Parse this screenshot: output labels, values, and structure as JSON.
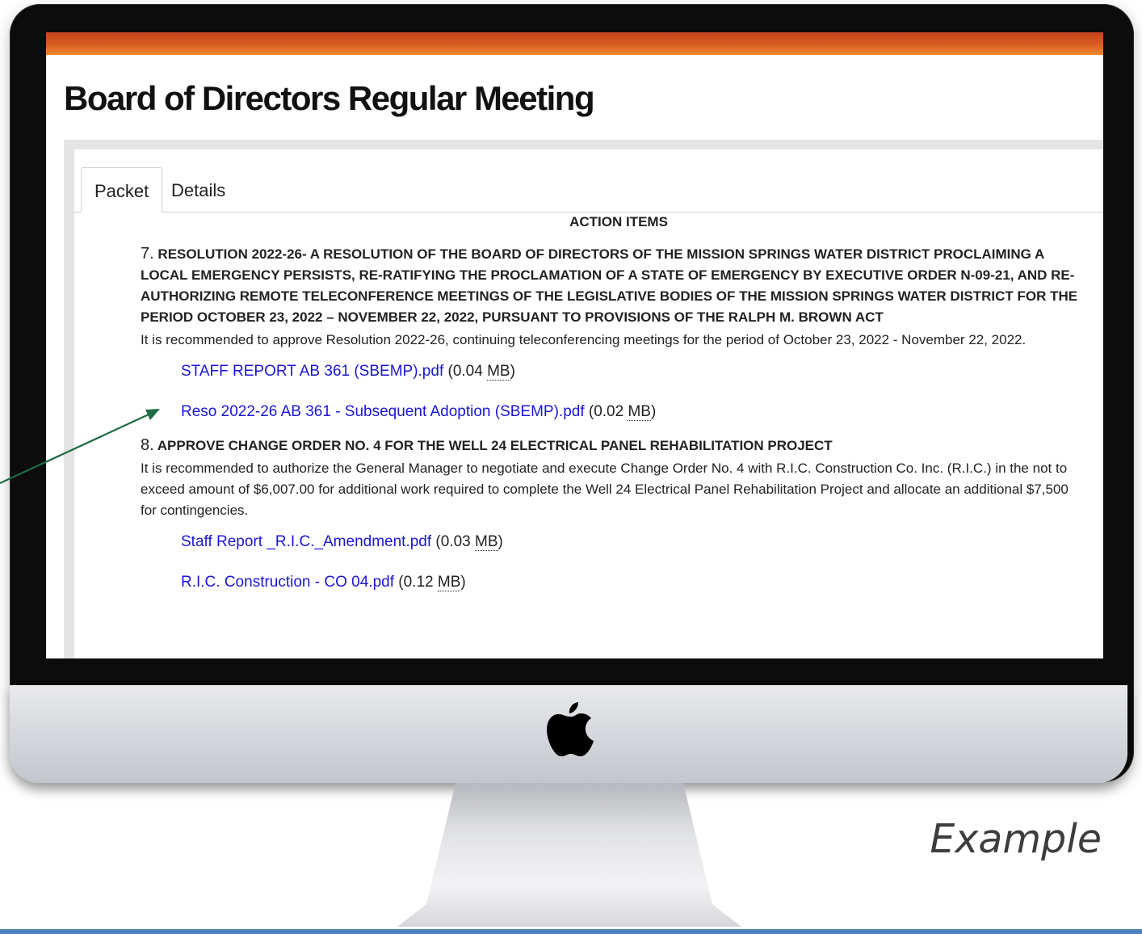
{
  "page": {
    "title": "Board of Directors Regular Meeting",
    "tabs": [
      {
        "label": "Packet",
        "active": true
      },
      {
        "label": "Details",
        "active": false
      }
    ]
  },
  "agenda": {
    "section_heading": "ACTION ITEMS",
    "items": [
      {
        "number": "7.",
        "title": "RESOLUTION 2022-26- A RESOLUTION OF THE BOARD OF DIRECTORS OF THE MISSION SPRINGS WATER DISTRICT PROCLAIMING A LOCAL EMERGENCY PERSISTS, RE-RATIFYING THE PROCLAMATION OF A STATE OF EMERGENCY BY EXECUTIVE ORDER N-09-21, AND RE-AUTHORIZING REMOTE TELECONFERENCE MEETINGS OF THE LEGISLATIVE BODIES OF THE MISSION SPRINGS WATER DISTRICT FOR THE PERIOD OCTOBER 23, 2022 – NOVEMBER 22, 2022, PURSUANT TO PROVISIONS OF THE RALPH M. BROWN ACT",
        "description": "It is recommended to approve Resolution 2022-26, continuing teleconferencing meetings for the period of October 23, 2022 - November 22, 2022.",
        "attachments": [
          {
            "name": "STAFF REPORT AB 361 (SBEMP).pdf",
            "size_open": " (0.04 ",
            "unit": "MB",
            "size_close": ")"
          },
          {
            "name": "Reso 2022-26 AB 361 - Subsequent Adoption (SBEMP).pdf",
            "size_open": " (0.02 ",
            "unit": "MB",
            "size_close": ")"
          }
        ]
      },
      {
        "number": "8.",
        "title": "APPROVE CHANGE ORDER NO. 4 FOR THE WELL 24 ELECTRICAL PANEL REHABILITATION PROJECT",
        "description": "It is recommended to authorize the General Manager to negotiate and execute Change Order No. 4 with R.I.C. Construction Co. Inc. (R.I.C.) in the not to exceed amount of $6,007.00 for additional work required to complete the Well 24 Electrical Panel Rehabilitation Project and allocate an additional $7,500 for contingencies.",
        "attachments": [
          {
            "name": "Staff Report _R.I.C._Amendment.pdf",
            "size_open": " (0.03 ",
            "unit": "MB",
            "size_close": ")"
          },
          {
            "name": "R.I.C. Construction - CO 04.pdf",
            "size_open": " (0.12 ",
            "unit": "MB",
            "size_close": ")"
          }
        ]
      }
    ]
  },
  "caption": "Example",
  "colors": {
    "link": "#1a16d6",
    "top_bar_start": "#c8431f",
    "top_bar_end": "#f0892d",
    "arrow": "#1f6b43",
    "base_line": "#4e81bd"
  },
  "icons": {
    "logo": "apple-logo-icon",
    "pointer": "arrow-pointer-icon"
  }
}
